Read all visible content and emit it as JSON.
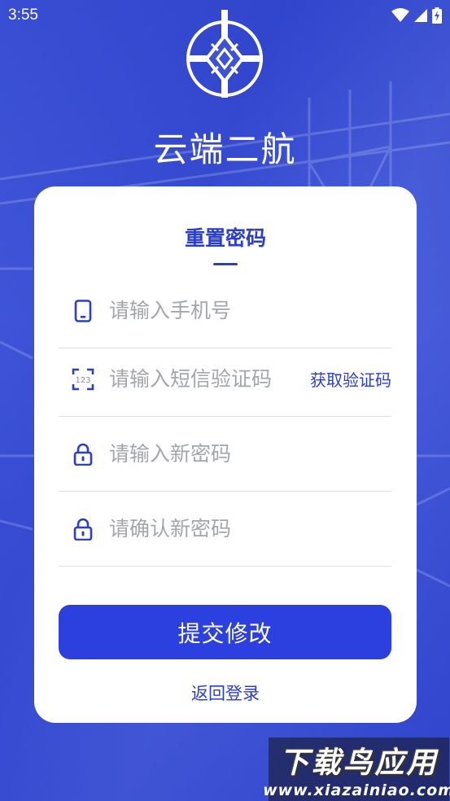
{
  "status_bar": {
    "time": "3:55"
  },
  "app": {
    "title": "云端二航"
  },
  "form": {
    "title": "重置密码",
    "phone_placeholder": "请输入手机号",
    "code_placeholder": "请输入短信验证码",
    "code_icon_text": "123",
    "get_code_label": "获取验证码",
    "new_password_placeholder": "请输入新密码",
    "confirm_password_placeholder": "请确认新密码",
    "submit_label": "提交修改",
    "back_label": "返回登录"
  },
  "watermark": {
    "main": "下载鸟应用",
    "sub": "www.xiazainiao.com"
  },
  "colors": {
    "accent": "#2b40de",
    "background": "#3d52d6"
  }
}
